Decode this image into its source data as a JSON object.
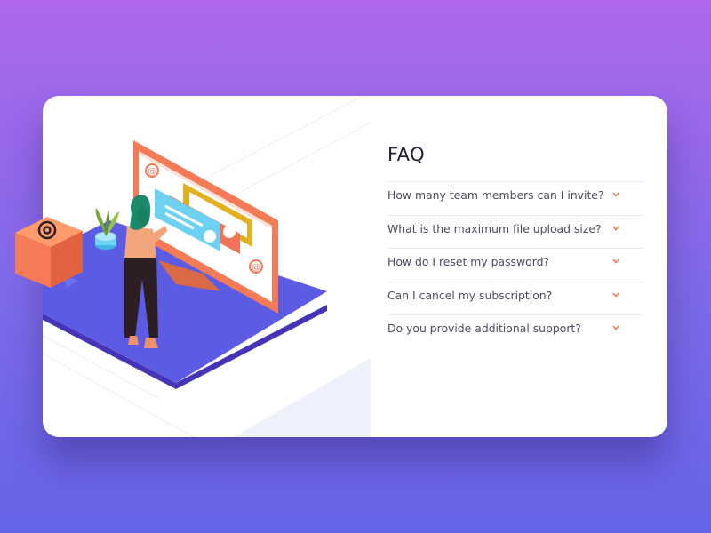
{
  "faq": {
    "title": "FAQ",
    "items": [
      {
        "question": "How many team members can I invite?",
        "icon": "chevron-down-icon"
      },
      {
        "question": "What is the maximum file upload size?",
        "icon": "chevron-down-icon"
      },
      {
        "question": "How do I reset my password?",
        "icon": "chevron-down-icon"
      },
      {
        "question": "Can I cancel my subscription?",
        "icon": "chevron-down-icon"
      },
      {
        "question": "Do you provide additional support?",
        "icon": "chevron-down-icon"
      }
    ]
  },
  "colors": {
    "background_top": "#ae67ec",
    "background_bottom": "#6564e7",
    "accent": "#f47b56",
    "title": "#1d1e35",
    "question_text": "#4a4b5e",
    "platform": "#5a55e0"
  },
  "illustration": {
    "name": "woman-online-illustration"
  }
}
